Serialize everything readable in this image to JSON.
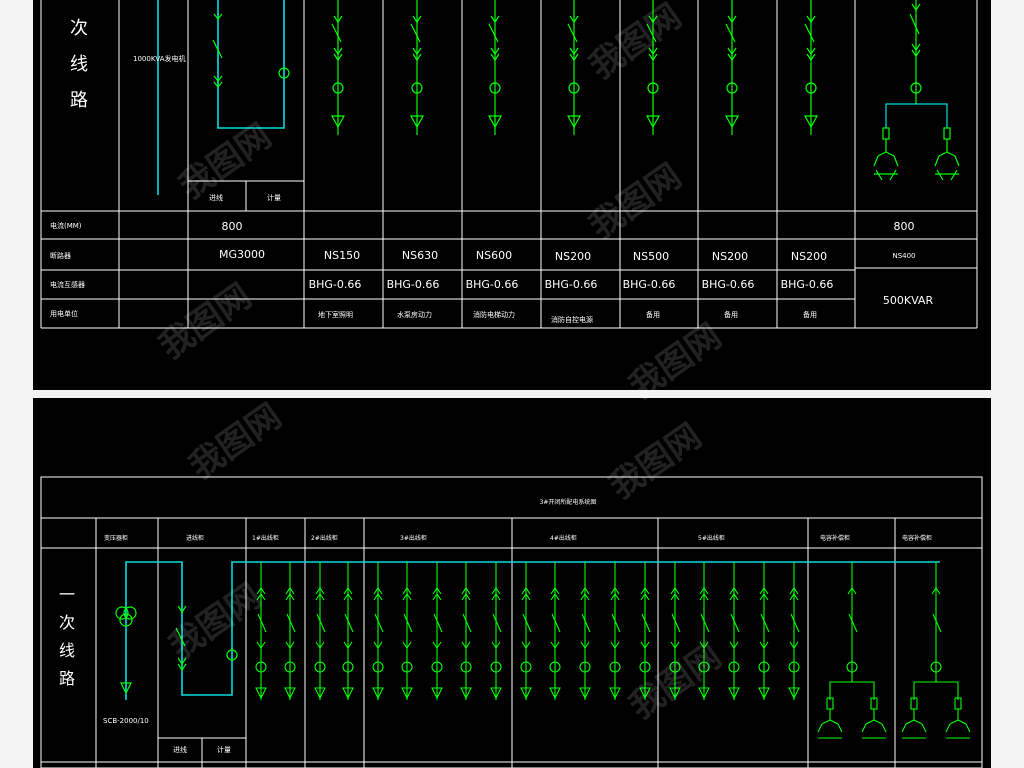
{
  "top": {
    "side_title": [
      "次",
      "线",
      "路"
    ],
    "generator_label": "1000KVA发电机",
    "sub_labels": [
      "进线",
      "计量"
    ],
    "row_headers": [
      "电流(MM)",
      "断路器",
      "电流互感器",
      "用电单位"
    ],
    "current_values": [
      "800",
      "800"
    ],
    "main_breaker": "MG3000",
    "breakers": [
      "NS150",
      "NS630",
      "NS600",
      "NS200",
      "NS500",
      "NS200",
      "NS200"
    ],
    "right_breaker": "NS400",
    "ct_values": [
      "BHG-0.66",
      "BHG-0.66",
      "BHG-0.66",
      "BHG-0.66",
      "BHG-0.66",
      "BHG-0.66",
      "BHG-0.66"
    ],
    "capacitor": "500KVAR",
    "usage": [
      "地下室照明",
      "水泵房动力",
      "消防电梯动力",
      "消防自控电源",
      "备用",
      "备用",
      "备用"
    ]
  },
  "bottom": {
    "title": "3#开闭所配电系统图",
    "side_title": [
      "一",
      "次",
      "线",
      "路"
    ],
    "headers": [
      "变压器柜",
      "进线柜",
      "1#出线柜",
      "2#出线柜",
      "3#出线柜",
      "4#出线柜",
      "5#出线柜",
      "电容补偿柜",
      "电容补偿柜"
    ],
    "transformer": "SCB-2000/10",
    "sub_labels": [
      "进线",
      "计量"
    ]
  },
  "watermark": "我图网",
  "colors": {
    "panel": "#000000",
    "line": "#ffffff",
    "circuit": "#00ff00",
    "bus": "#00ffff"
  }
}
